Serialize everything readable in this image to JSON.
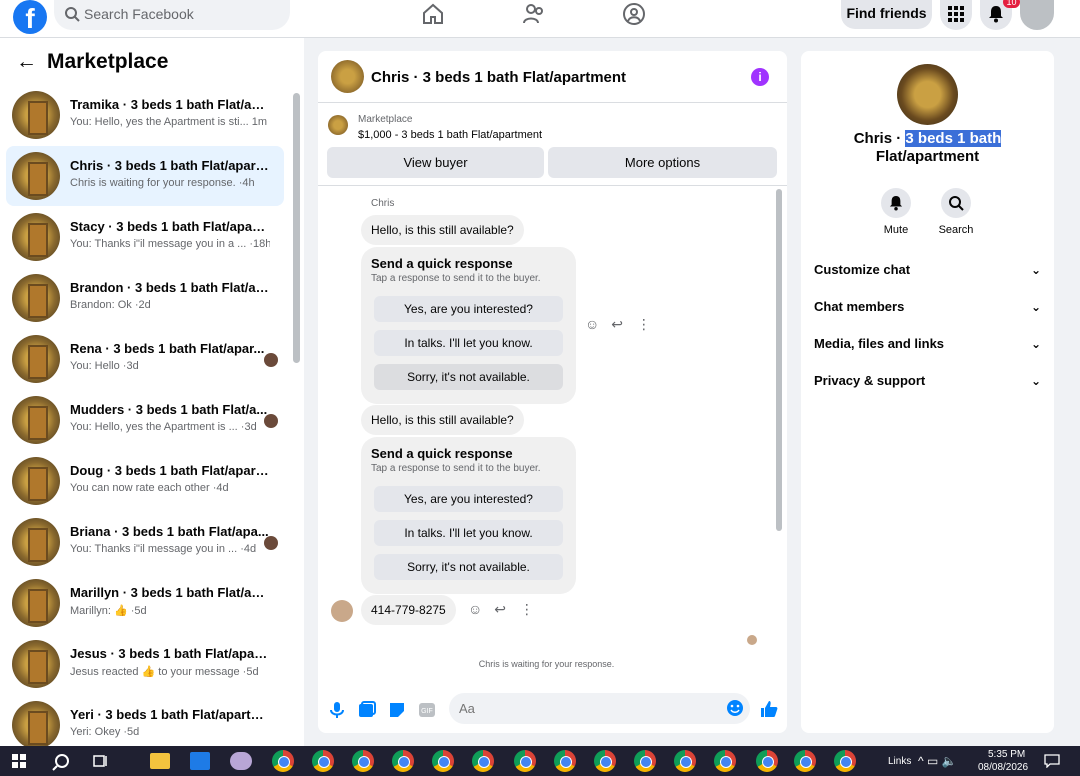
{
  "topbar": {
    "logo": "f",
    "search_placeholder": "Search Facebook",
    "find_friends": "Find friends",
    "notification_count": "10"
  },
  "sidebar": {
    "title": "Marketplace",
    "chats": [
      {
        "title": "Tramika · 3 beds 1 bath Flat/apar...",
        "sub": "You: Hello, yes the Apartment is sti... 1m",
        "mini": false
      },
      {
        "title": "Chris · 3 beds 1 bath Flat/apartm...",
        "sub": "Chris is waiting for your response. ·4h",
        "mini": false
      },
      {
        "title": "Stacy · 3 beds 1 bath Flat/apartm...",
        "sub": "You: Thanks i\"il message you in a ... ·18h",
        "mini": false
      },
      {
        "title": "Brandon · 3 beds 1 bath Flat/apa...",
        "sub": "Brandon: Ok ·2d",
        "mini": false
      },
      {
        "title": "Rena · 3 beds 1 bath Flat/apar...",
        "sub": "You: Hello ·3d",
        "mini": true
      },
      {
        "title": "Mudders · 3 beds 1 bath Flat/a...",
        "sub": "You: Hello, yes the Apartment is ... ·3d",
        "mini": true
      },
      {
        "title": "Doug · 3 beds 1 bath Flat/apart...",
        "sub": "You can now rate each other ·4d",
        "mini": false
      },
      {
        "title": "Briana · 3 beds 1 bath Flat/apa...",
        "sub": "You: Thanks i\"il message you in ... ·4d",
        "mini": true
      },
      {
        "title": "Marillyn · 3 beds 1 bath Flat/apa...",
        "sub": "Marillyn: 👍 ·5d",
        "mini": false
      },
      {
        "title": "Jesus · 3 beds 1 bath Flat/apartm...",
        "sub": "Jesus reacted 👍 to your message ·5d",
        "mini": false
      },
      {
        "title": "Yeri · 3 beds 1 bath Flat/apartment",
        "sub": "Yeri: Okey ·5d",
        "mini": false
      }
    ]
  },
  "chat": {
    "title": "Chris · 3 beds 1 bath Flat/apartment",
    "listing_source": "Marketplace",
    "listing_price": "$1,000 - 3 beds 1 bath Flat/apartment",
    "view_buyer": "View buyer",
    "more_options": "More options",
    "sender": "Chris",
    "message_1": "Hello, is this still available?",
    "message_2": "Hello, is this still available?",
    "quick_title": "Send a quick response",
    "quick_sub": "Tap a response to send it to the buyer.",
    "quick_options": [
      "Yes, are you interested?",
      "In talks. I'll let you know.",
      "Sorry, it's not available."
    ],
    "phone_message": "414-779-8275",
    "waiting_text": "Chris is waiting for your response.",
    "input_placeholder": "Aa"
  },
  "details": {
    "name_plain": "Chris · ",
    "name_selected": "3 beds 1 bath",
    "name_line2": "Flat/apartment",
    "mute": "Mute",
    "search": "Search",
    "sections": [
      "Customize chat",
      "Chat members",
      "Media, files and links",
      "Privacy & support"
    ]
  },
  "taskbar": {
    "links": "Links",
    "time": "5:35 PM",
    "date": "08/08/2026"
  },
  "colors": {
    "brand": "#1877f2",
    "accent": "#0084ff",
    "info": "#a033ff",
    "selection": "#3b6fd8"
  }
}
